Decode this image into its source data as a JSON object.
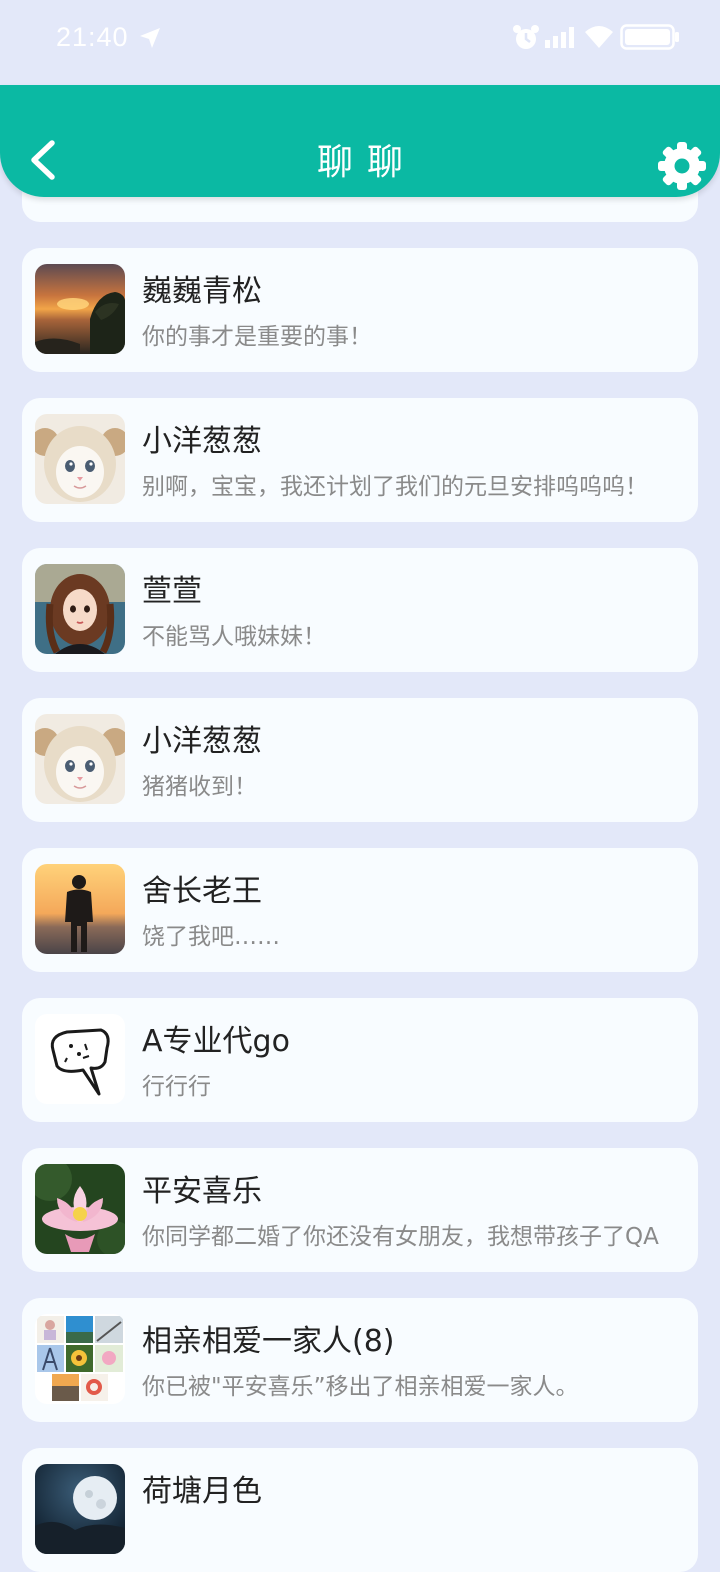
{
  "status_bar": {
    "time": "21:40"
  },
  "header": {
    "title": "聊聊",
    "back_icon": "chevron-left-icon",
    "settings_icon": "gear-icon"
  },
  "colors": {
    "accent": "#0bb9a3",
    "background": "#e3e8f9",
    "card": "#f8fcff",
    "name_text": "#222222",
    "message_text": "#8a8a8a"
  },
  "chats": [
    {
      "name": "巍巍青松",
      "message": "你的事才是重要的事！"
    },
    {
      "name": "小洋葱葱",
      "message": "别啊，宝宝，我还计划了我们的元旦安排呜呜呜！"
    },
    {
      "name": "萱萱",
      "message": "不能骂人哦妹妹！"
    },
    {
      "name": "小洋葱葱",
      "message": "猪猪收到！"
    },
    {
      "name": "舍长老王",
      "message": "饶了我吧……"
    },
    {
      "name": "A专业代go",
      "message": "行行行"
    },
    {
      "name": "平安喜乐",
      "message": "你同学都二婚了你还没有女朋友，我想带孩子了QA"
    },
    {
      "name": "相亲相爱一家人(8)",
      "message": "你已被\"平安喜乐”移出了相亲相爱一家人。"
    },
    {
      "name": "荷塘月色",
      "message": ""
    }
  ]
}
